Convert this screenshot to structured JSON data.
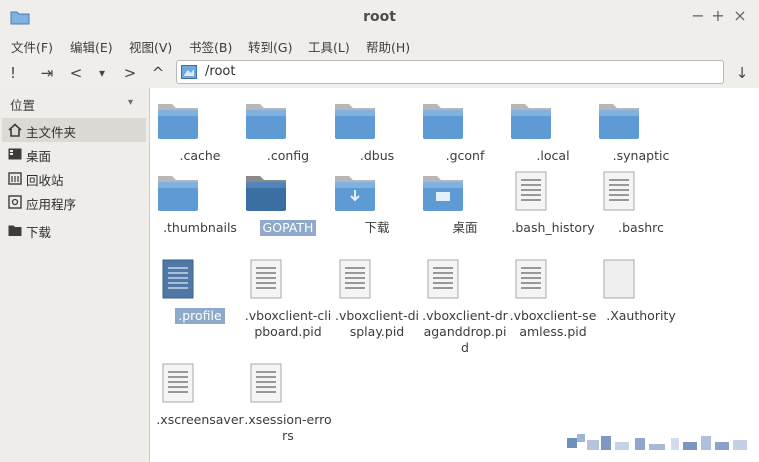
{
  "window": {
    "title": "root"
  },
  "window_controls": {
    "minimize": "−",
    "maximize": "+",
    "close": "×"
  },
  "menu": [
    "文件(F)",
    "编辑(E)",
    "视图(V)",
    "书签(B)",
    "转到(G)",
    "工具(L)",
    "帮助(H)"
  ],
  "toolbar": {
    "btn1": "!",
    "btn2": "⇥",
    "back": "<",
    "history": "▾",
    "forward": ">",
    "up": "^",
    "path": "/root",
    "end": "↓"
  },
  "sidebar": {
    "header": "位置",
    "caret": "▾",
    "items": [
      {
        "label": "主文件夹",
        "icon": "home-icon"
      },
      {
        "label": "桌面",
        "icon": "desktop-icon"
      },
      {
        "label": "回收站",
        "icon": "trash-icon"
      },
      {
        "label": "应用程序",
        "icon": "apps-icon"
      },
      {
        "label": "下载",
        "icon": "folder-icon"
      }
    ]
  },
  "files": [
    {
      "name": ".cache",
      "type": "folder"
    },
    {
      "name": ".config",
      "type": "folder"
    },
    {
      "name": ".dbus",
      "type": "folder"
    },
    {
      "name": ".gconf",
      "type": "folder"
    },
    {
      "name": ".local",
      "type": "folder"
    },
    {
      "name": ".synaptic",
      "type": "folder"
    },
    {
      "name": ".thumbnails",
      "type": "folder"
    },
    {
      "name": "GOPATH",
      "type": "folder"
    },
    {
      "name": "下载",
      "type": "download-folder"
    },
    {
      "name": "桌面",
      "type": "desktop-folder"
    },
    {
      "name": ".bash_history",
      "type": "text"
    },
    {
      "name": ".bashrc",
      "type": "text"
    },
    {
      "name": ".profile",
      "type": "text"
    },
    {
      "name": ".vboxclient-clipboard.pid",
      "type": "text"
    },
    {
      "name": ".vboxclient-display.pid",
      "type": "text"
    },
    {
      "name": ".vboxclient-draganddrop.pid",
      "type": "text"
    },
    {
      "name": ".vboxclient-seamless.pid",
      "type": "text"
    },
    {
      "name": ".Xauthority",
      "type": "blank"
    },
    {
      "name": ".xscreensaver",
      "type": "text"
    },
    {
      "name": ".xsession-errors",
      "type": "text"
    }
  ],
  "colors": {
    "folder_blue": "#5e9bd4",
    "selection": "#8ea9c9",
    "chrome": "#efeeea"
  }
}
